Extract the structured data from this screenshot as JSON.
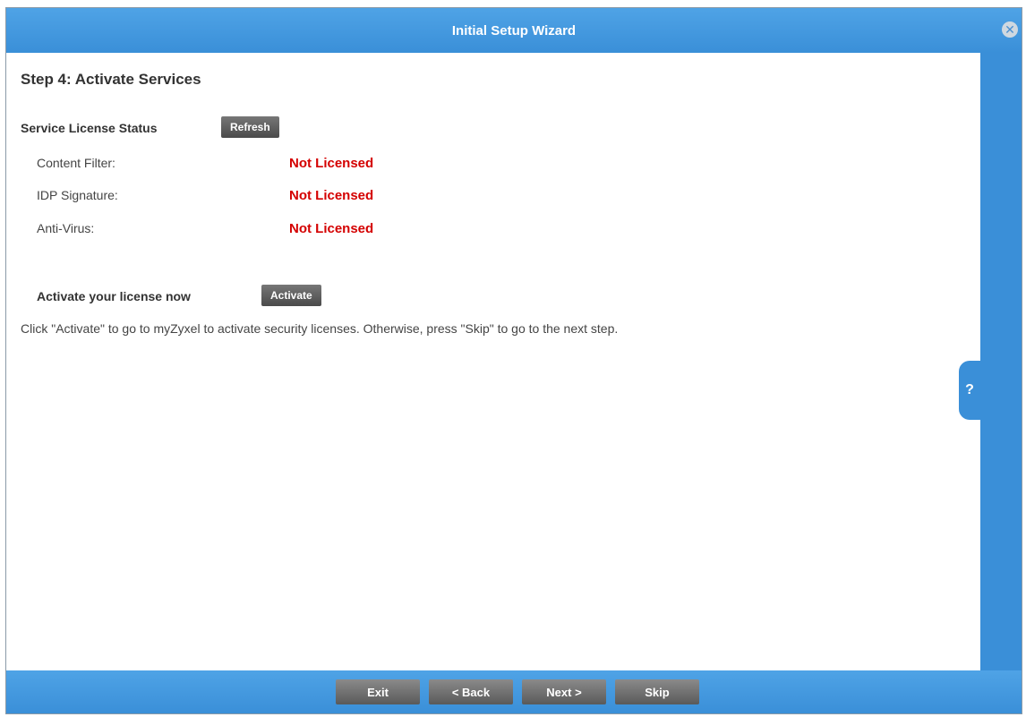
{
  "window": {
    "title": "Initial Setup Wizard",
    "close_icon": "✕"
  },
  "step": {
    "title": "Step 4: Activate Services"
  },
  "license_status": {
    "heading": "Service License Status",
    "refresh_label": "Refresh",
    "rows": [
      {
        "label": "Content Filter:",
        "value": "Not Licensed"
      },
      {
        "label": "IDP Signature:",
        "value": "Not Licensed"
      },
      {
        "label": "Anti-Virus:",
        "value": "Not Licensed"
      }
    ]
  },
  "activate": {
    "heading": "Activate your license now",
    "button_label": "Activate",
    "description": "Click \"Activate\" to go to myZyxel to activate security licenses. Otherwise, press \"Skip\" to go to the next step."
  },
  "help": {
    "label": "?"
  },
  "footer": {
    "exit_label": "Exit",
    "back_label": "< Back",
    "next_label": "Next >",
    "skip_label": "Skip"
  },
  "colors": {
    "accent": "#3a8fd8",
    "status_error": "#d40000",
    "button_dark": "#4a4a4a"
  },
  "icons": {
    "close": "close-icon",
    "help": "help-icon"
  }
}
